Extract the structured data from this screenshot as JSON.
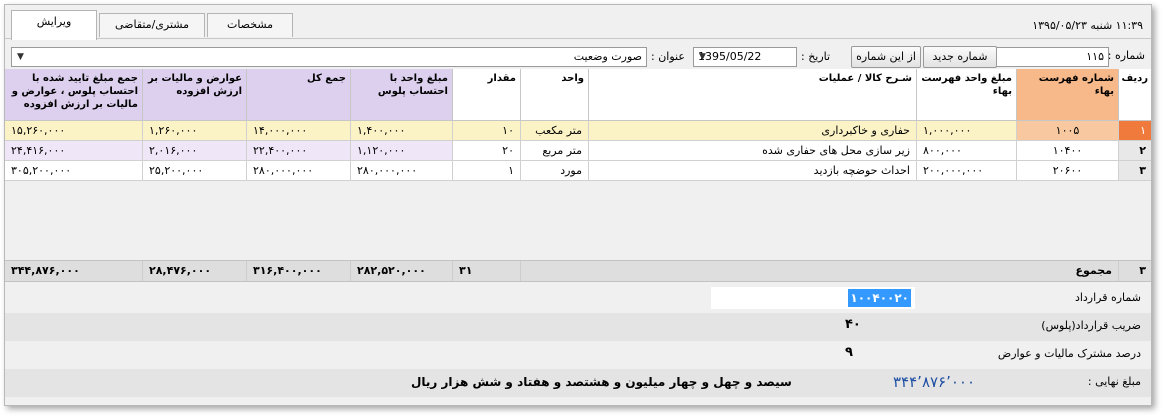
{
  "header": {
    "tabs": [
      {
        "label": "ویرایش",
        "active": true
      },
      {
        "label": "مشتری/متقاضی",
        "active": false
      },
      {
        "label": "مشخصات",
        "active": false
      }
    ],
    "datetime": "۱۱:۳۹    شنبه ۱۳۹۵/۰۵/۲۳"
  },
  "form": {
    "number_label": "شماره :",
    "number_value": "۱۱۵",
    "new_number_button": "شماره جدید",
    "from_number_button": "از این شماره",
    "date_label": "تاریخ :",
    "date_value": "1395/05/22",
    "title_label": "عنوان :",
    "title_value": "صورت وضعیت"
  },
  "grid": {
    "columns": [
      {
        "key": "radif",
        "label": "ردیف"
      },
      {
        "key": "code",
        "label": "شماره فهرست بهاء"
      },
      {
        "key": "unit_price_list",
        "label": "مبلغ واحد فهرست بهاء"
      },
      {
        "key": "desc",
        "label": "شـرح کالا / عملیات"
      },
      {
        "key": "unit",
        "label": "واحد"
      },
      {
        "key": "qty",
        "label": "مقدار"
      },
      {
        "key": "unit_price_plus",
        "label": "مبلغ واحد با احتساب پلوس"
      },
      {
        "key": "total",
        "label": "جمع کل"
      },
      {
        "key": "tax",
        "label": "عوارض و مالیات بر ارزش افزوده"
      },
      {
        "key": "grand",
        "label": "جمع مبلغ تایید شده با احتساب پلوس ، عوارض و مالیات بر ارزش افزوده"
      }
    ],
    "rows": [
      {
        "radif": "۱",
        "code": "۱۰۰۵",
        "unit_price_list": "۱,۰۰۰,۰۰۰",
        "desc": "حفاری و خاکبرداری",
        "unit": "متر مکعب",
        "qty": "۱۰",
        "unit_price_plus": "۱,۴۰۰,۰۰۰",
        "total": "۱۴,۰۰۰,۰۰۰",
        "tax": "۱,۲۶۰,۰۰۰",
        "grand": "۱۵,۲۶۰,۰۰۰"
      },
      {
        "radif": "۲",
        "code": "۱۰۴۰۰",
        "unit_price_list": "۸۰۰,۰۰۰",
        "desc": "زیر سازی محل های حفاری شده",
        "unit": "متر مربع",
        "qty": "۲۰",
        "unit_price_plus": "۱,۱۲۰,۰۰۰",
        "total": "۲۲,۴۰۰,۰۰۰",
        "tax": "۲,۰۱۶,۰۰۰",
        "grand": "۲۴,۴۱۶,۰۰۰"
      },
      {
        "radif": "۳",
        "code": "۲۰۶۰۰",
        "unit_price_list": "۲۰۰,۰۰۰,۰۰۰",
        "desc": "احداث حوضچه بازدید",
        "unit": "مورد",
        "qty": "۱",
        "unit_price_plus": "۲۸۰,۰۰۰,۰۰۰",
        "total": "۲۸۰,۰۰۰,۰۰۰",
        "tax": "۲۵,۲۰۰,۰۰۰",
        "grand": "۳۰۵,۲۰۰,۰۰۰"
      }
    ],
    "totals": {
      "count": "۳",
      "label": "مجموع",
      "qty": "۳۱",
      "unit_price_plus": "۲۸۲,۵۲۰,۰۰۰",
      "total": "۳۱۶,۴۰۰,۰۰۰",
      "tax": "۲۸,۴۷۶,۰۰۰",
      "grand": "۳۴۴,۸۷۶,۰۰۰"
    }
  },
  "info": {
    "contract_number_label": "شماره قرارداد",
    "contract_number_value": "۱۰۰۴۰۰۲۰",
    "plus_label": "ضریب قرارداد(پلوس)",
    "plus_value": "۴۰",
    "tax_percent_label": "درصد مشترک مالیات و عوارض",
    "tax_percent_value": "۹",
    "final_label": "مبلغ نهایی :",
    "final_amount": "۳۴۴٬۸۷۶٬۰۰۰",
    "final_words": "سیصد و چهل و چهار میلیون و هشتصد و هفتاد و شش هزار  ریال"
  }
}
